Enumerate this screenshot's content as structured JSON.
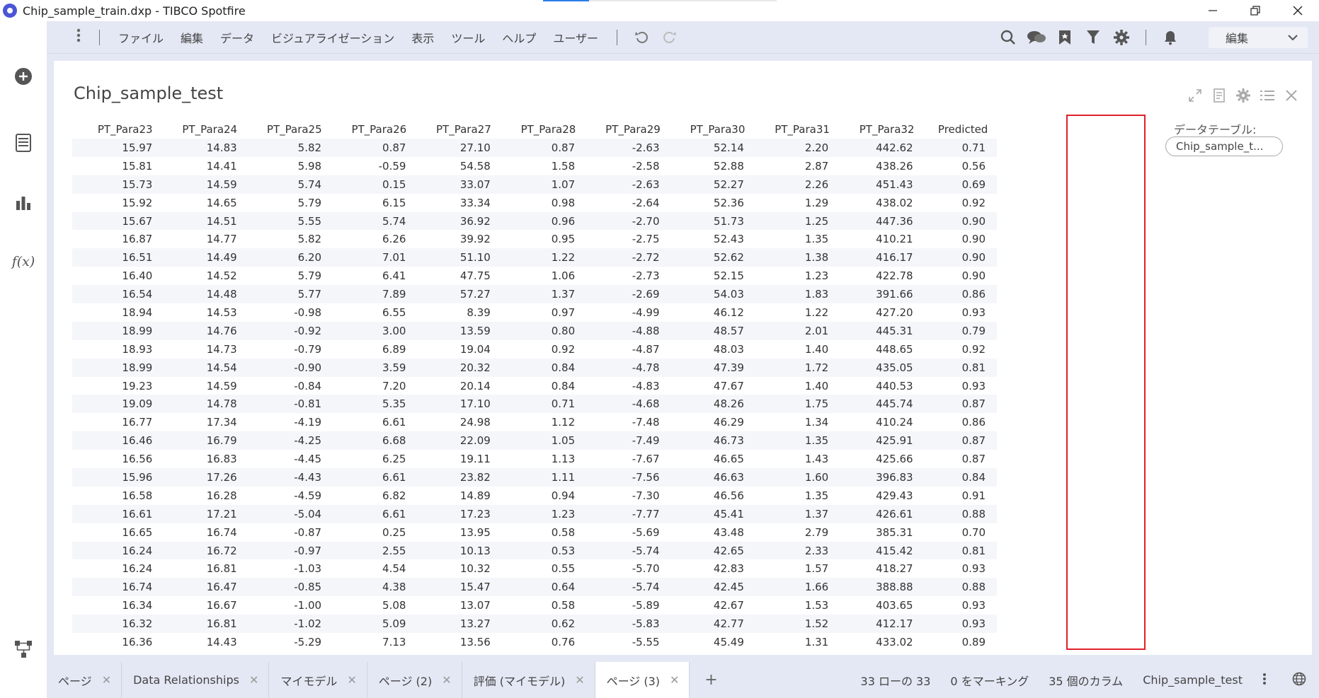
{
  "window": {
    "title": "Chip_sample_train.dxp - TIBCO Spotfire",
    "controls": [
      "minimize",
      "restore",
      "close"
    ]
  },
  "menubar": {
    "items": [
      "ファイル",
      "編集",
      "データ",
      "ビジュアライゼーション",
      "表示",
      "ツール",
      "ヘルプ",
      "ユーザー"
    ],
    "mode_select": "編集"
  },
  "panel": {
    "title": "Chip_sample_test",
    "datatable_label": "データテーブル:",
    "datatable_value": "Chip_sample_t..."
  },
  "table": {
    "columns": [
      "PT_Para23",
      "PT_Para24",
      "PT_Para25",
      "PT_Para26",
      "PT_Para27",
      "PT_Para28",
      "PT_Para29",
      "PT_Para30",
      "PT_Para31",
      "PT_Para32",
      "Predicted"
    ],
    "rows": [
      [
        "15.97",
        "14.83",
        "5.82",
        "0.87",
        "27.10",
        "0.87",
        "-2.63",
        "52.14",
        "2.20",
        "442.62",
        "0.71"
      ],
      [
        "15.81",
        "14.41",
        "5.98",
        "-0.59",
        "54.58",
        "1.58",
        "-2.58",
        "52.88",
        "2.87",
        "438.26",
        "0.56"
      ],
      [
        "15.73",
        "14.59",
        "5.74",
        "0.15",
        "33.07",
        "1.07",
        "-2.63",
        "52.27",
        "2.26",
        "451.43",
        "0.69"
      ],
      [
        "15.92",
        "14.65",
        "5.79",
        "6.15",
        "33.34",
        "0.98",
        "-2.64",
        "52.36",
        "1.29",
        "438.02",
        "0.92"
      ],
      [
        "15.67",
        "14.51",
        "5.55",
        "5.74",
        "36.92",
        "0.96",
        "-2.70",
        "51.73",
        "1.25",
        "447.36",
        "0.90"
      ],
      [
        "16.87",
        "14.77",
        "5.82",
        "6.26",
        "39.92",
        "0.95",
        "-2.75",
        "52.43",
        "1.35",
        "410.21",
        "0.90"
      ],
      [
        "16.51",
        "14.49",
        "6.20",
        "7.01",
        "51.10",
        "1.22",
        "-2.72",
        "52.62",
        "1.38",
        "416.17",
        "0.90"
      ],
      [
        "16.40",
        "14.52",
        "5.79",
        "6.41",
        "47.75",
        "1.06",
        "-2.73",
        "52.15",
        "1.23",
        "422.78",
        "0.90"
      ],
      [
        "16.54",
        "14.48",
        "5.77",
        "7.89",
        "57.27",
        "1.37",
        "-2.69",
        "54.03",
        "1.83",
        "391.66",
        "0.86"
      ],
      [
        "18.94",
        "14.53",
        "-0.98",
        "6.55",
        "8.39",
        "0.97",
        "-4.99",
        "46.12",
        "1.22",
        "427.20",
        "0.93"
      ],
      [
        "18.99",
        "14.76",
        "-0.92",
        "3.00",
        "13.59",
        "0.80",
        "-4.88",
        "48.57",
        "2.01",
        "445.31",
        "0.79"
      ],
      [
        "18.93",
        "14.73",
        "-0.79",
        "6.89",
        "19.04",
        "0.92",
        "-4.87",
        "48.03",
        "1.40",
        "448.65",
        "0.92"
      ],
      [
        "18.99",
        "14.54",
        "-0.90",
        "3.59",
        "20.32",
        "0.84",
        "-4.78",
        "47.39",
        "1.72",
        "435.05",
        "0.81"
      ],
      [
        "19.23",
        "14.59",
        "-0.84",
        "7.20",
        "20.14",
        "0.84",
        "-4.83",
        "47.67",
        "1.40",
        "440.53",
        "0.93"
      ],
      [
        "19.09",
        "14.78",
        "-0.81",
        "5.35",
        "17.10",
        "0.71",
        "-4.68",
        "48.26",
        "1.75",
        "445.74",
        "0.87"
      ],
      [
        "16.77",
        "17.34",
        "-4.19",
        "6.61",
        "24.98",
        "1.12",
        "-7.48",
        "46.29",
        "1.34",
        "410.24",
        "0.86"
      ],
      [
        "16.46",
        "16.79",
        "-4.25",
        "6.68",
        "22.09",
        "1.05",
        "-7.49",
        "46.73",
        "1.35",
        "425.91",
        "0.87"
      ],
      [
        "16.56",
        "16.83",
        "-4.45",
        "6.25",
        "19.11",
        "1.13",
        "-7.67",
        "46.65",
        "1.43",
        "425.66",
        "0.87"
      ],
      [
        "15.96",
        "17.26",
        "-4.43",
        "6.61",
        "23.82",
        "1.11",
        "-7.56",
        "46.63",
        "1.60",
        "396.83",
        "0.84"
      ],
      [
        "16.58",
        "16.28",
        "-4.59",
        "6.82",
        "14.89",
        "0.94",
        "-7.30",
        "46.56",
        "1.35",
        "429.43",
        "0.91"
      ],
      [
        "16.61",
        "17.21",
        "-5.04",
        "6.61",
        "17.23",
        "1.23",
        "-7.77",
        "45.41",
        "1.37",
        "426.61",
        "0.88"
      ],
      [
        "16.65",
        "16.74",
        "-0.87",
        "0.25",
        "13.95",
        "0.58",
        "-5.69",
        "43.48",
        "2.79",
        "385.31",
        "0.70"
      ],
      [
        "16.24",
        "16.72",
        "-0.97",
        "2.55",
        "10.13",
        "0.53",
        "-5.74",
        "42.65",
        "2.33",
        "415.42",
        "0.81"
      ],
      [
        "16.24",
        "16.81",
        "-1.03",
        "4.54",
        "10.32",
        "0.55",
        "-5.70",
        "42.83",
        "1.57",
        "418.27",
        "0.93"
      ],
      [
        "16.74",
        "16.47",
        "-0.85",
        "4.38",
        "15.47",
        "0.64",
        "-5.74",
        "42.45",
        "1.66",
        "388.88",
        "0.88"
      ],
      [
        "16.34",
        "16.67",
        "-1.00",
        "5.08",
        "13.07",
        "0.58",
        "-5.89",
        "42.67",
        "1.53",
        "403.65",
        "0.93"
      ],
      [
        "16.32",
        "16.81",
        "-1.02",
        "5.09",
        "13.27",
        "0.62",
        "-5.83",
        "42.77",
        "1.52",
        "412.17",
        "0.93"
      ],
      [
        "16.36",
        "14.43",
        "-5.29",
        "7.13",
        "13.56",
        "0.76",
        "-5.55",
        "45.49",
        "1.31",
        "433.02",
        "0.89"
      ]
    ]
  },
  "tabs": [
    {
      "label": "ページ",
      "active": false
    },
    {
      "label": "Data Relationships",
      "active": false
    },
    {
      "label": "マイモデル",
      "active": false
    },
    {
      "label": "ページ (2)",
      "active": false
    },
    {
      "label": "評価 (マイモデル)",
      "active": false
    },
    {
      "label": "ページ (3)",
      "active": true
    }
  ],
  "status": {
    "rows": "33 ローの 33",
    "marked": "0 をマーキング",
    "columns": "35 個のカラム",
    "table": "Chip_sample_test"
  },
  "colors": {
    "accent": "#4b56d6",
    "highlight": "#e0202a",
    "chrome": "#e4e8f4"
  }
}
